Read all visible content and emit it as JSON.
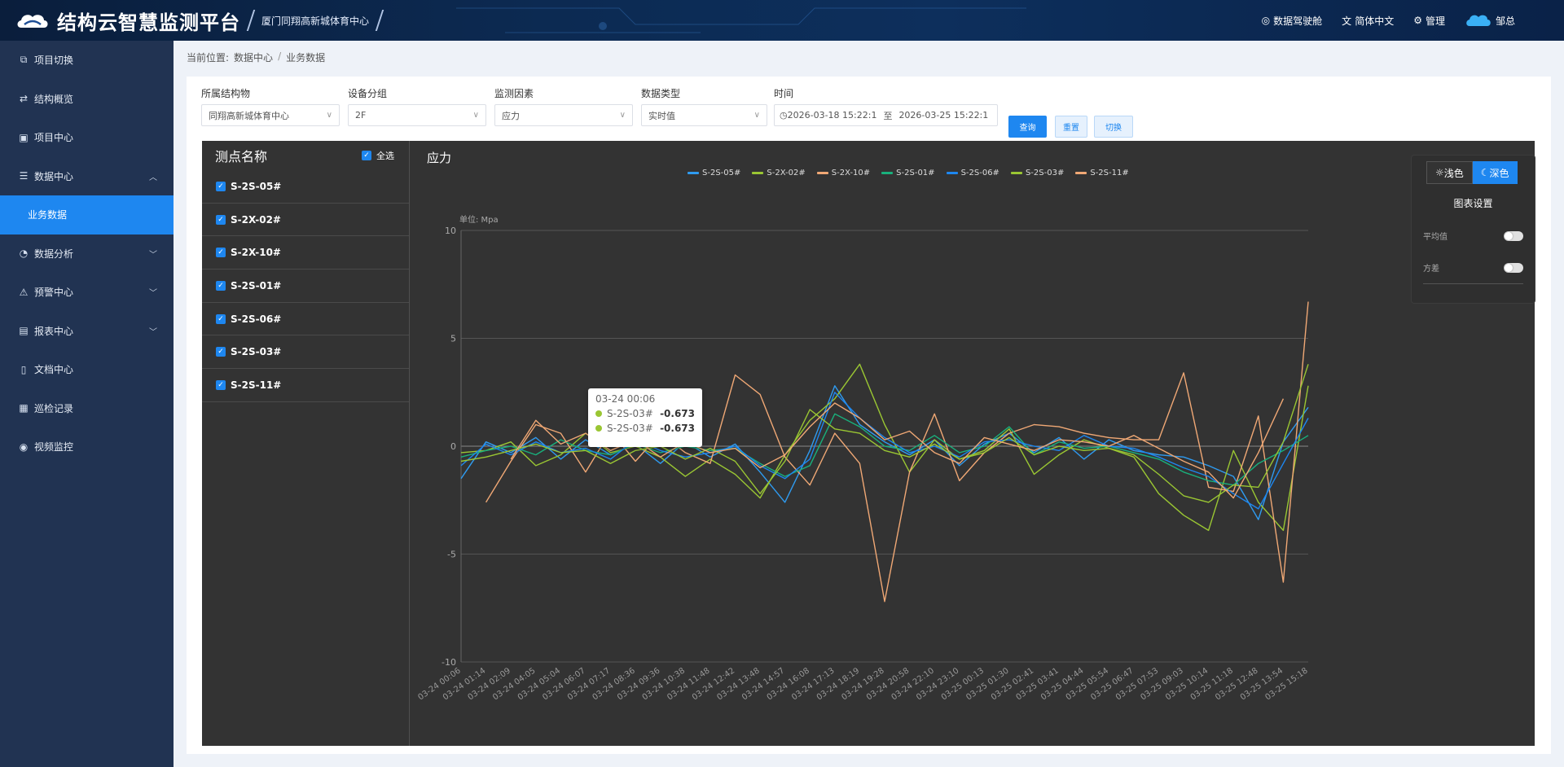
{
  "app": {
    "title": "结构云智慧监测平台",
    "project": "厦门同翔高新城体育中心"
  },
  "topbar": {
    "cockpit": "数据驾驶舱",
    "language": "简体中文",
    "admin": "管理",
    "user": "邹总"
  },
  "sidebar": {
    "items": [
      {
        "label": "项目切换",
        "icon": "switch-icon"
      },
      {
        "label": "结构概览",
        "icon": "structure-icon"
      },
      {
        "label": "项目中心",
        "icon": "project-icon"
      },
      {
        "label": "数据中心",
        "icon": "database-icon",
        "expanded": true
      },
      {
        "label": "业务数据",
        "sub": true,
        "active": true
      },
      {
        "label": "数据分析",
        "icon": "analysis-icon"
      },
      {
        "label": "预警中心",
        "icon": "alert-icon"
      },
      {
        "label": "报表中心",
        "icon": "report-icon"
      },
      {
        "label": "文档中心",
        "icon": "document-icon"
      },
      {
        "label": "巡检记录",
        "icon": "inspection-icon"
      },
      {
        "label": "视频监控",
        "icon": "camera-icon"
      }
    ]
  },
  "breadcrumb": {
    "prefix": "当前位置:",
    "level1": "数据中心",
    "separator": "/",
    "level2": "业务数据"
  },
  "filters": {
    "structure_label": "所属结构物",
    "structure_value": "同翔高新城体育中心",
    "group_label": "设备分组",
    "group_value": "2F",
    "factor_label": "监测因素",
    "factor_value": "应力",
    "datatype_label": "数据类型",
    "datatype_value": "实时值",
    "time_label": "时间",
    "time_start": "2026-03-18 15:22:1",
    "time_sep": "至",
    "time_end": "2026-03-25 15:22:1",
    "query": "查询",
    "reset": "重置",
    "switch": "切换"
  },
  "points": {
    "title": "测点名称",
    "select_all": "全选",
    "items": [
      "S-2S-05#",
      "S-2X-02#",
      "S-2X-10#",
      "S-2S-01#",
      "S-2S-06#",
      "S-2S-03#",
      "S-2S-11#"
    ]
  },
  "tooltip": {
    "time": "03-24 00:06",
    "rows": [
      {
        "name": "S-2S-03#",
        "value": "-0.673"
      },
      {
        "name": "S-2S-03#",
        "value": "-0.673"
      }
    ]
  },
  "settings": {
    "light": "浅色",
    "dark": "深色",
    "title": "图表设置",
    "avg": "平均值",
    "variance": "方差"
  },
  "chart_data": {
    "type": "line",
    "title": "应力",
    "unit_label": "单位:  Mpa",
    "ylim": [
      -10,
      10
    ],
    "yticks": [
      10,
      5,
      0,
      -5,
      -10
    ],
    "grid": true,
    "legend_position": "top-center",
    "categories": [
      "03-24 00:06",
      "03-24 01:14",
      "03-24 02:09",
      "03-24 04:05",
      "03-24 05:04",
      "03-24 06:07",
      "03-24 07:17",
      "03-24 08:36",
      "03-24 09:36",
      "03-24 10:38",
      "03-24 11:48",
      "03-24 12:42",
      "03-24 13:48",
      "03-24 14:57",
      "03-24 16:08",
      "03-24 17:13",
      "03-24 18:19",
      "03-24 19:28",
      "03-24 20:58",
      "03-24 22:10",
      "03-24 23:10",
      "03-25 00:13",
      "03-25 01:30",
      "03-25 02:41",
      "03-25 03:41",
      "03-25 04:44",
      "03-25 05:54",
      "03-25 06:47",
      "03-25 07:53",
      "03-25 09:03",
      "03-25 10:14",
      "03-25 11:18",
      "03-25 12:48",
      "03-25 13:54",
      "03-25 15:18"
    ],
    "series": [
      {
        "name": "S-2S-05#",
        "color": "#2f9bf0",
        "values": [
          -1.5,
          0.2,
          -0.3,
          0.4,
          -0.6,
          0.3,
          -0.4,
          0.1,
          -0.8,
          0.2,
          -0.5,
          0.1,
          -1.2,
          -2.6,
          -0.2,
          2.8,
          1.0,
          0.2,
          -0.4,
          0.3,
          -0.9,
          0.1,
          0.6,
          -0.3,
          0.4,
          -0.6,
          0.3,
          -0.2,
          -0.4,
          -0.5,
          -0.9,
          -1.4,
          -3.4,
          0.2,
          1.8
        ]
      },
      {
        "name": "S-2X-02#",
        "color": "#9ac633",
        "values": [
          -0.3,
          -0.2,
          0.2,
          -0.9,
          -0.4,
          0.6,
          -0.3,
          0.0,
          -0.5,
          -1.4,
          -0.6,
          -1.3,
          -2.4,
          -0.4,
          1.2,
          2.2,
          3.8,
          1.0,
          -1.2,
          0.3,
          -0.6,
          -0.2,
          0.8,
          -1.3,
          -0.4,
          0.3,
          -0.1,
          -0.5,
          -2.2,
          -3.2,
          -3.9,
          -0.2,
          -2.6,
          -3.9,
          2.8
        ]
      },
      {
        "name": "S-2X-10#",
        "color": "#f0a875",
        "values": [
          null,
          -2.6,
          -0.7,
          1.0,
          0.6,
          -1.2,
          0.7,
          -0.7,
          0.6,
          -0.3,
          -0.8,
          3.3,
          2.4,
          -0.5,
          -1.8,
          0.6,
          -0.8,
          -7.2,
          -1.2,
          1.5,
          -1.6,
          -0.3,
          0.6,
          1.0,
          0.9,
          0.6,
          0.4,
          0.3,
          0.3,
          3.4,
          -1.9,
          -2.1,
          1.4,
          -6.3,
          6.7
        ]
      },
      {
        "name": "S-2S-01#",
        "color": "#19b07c",
        "values": [
          -0.5,
          -0.2,
          0.0,
          -0.4,
          0.3,
          -0.2,
          -0.4,
          0.1,
          -0.3,
          0.0,
          -0.2,
          -0.1,
          -0.8,
          -1.4,
          -0.9,
          1.5,
          0.9,
          0.0,
          -0.2,
          0.5,
          -0.3,
          0.0,
          0.9,
          -0.4,
          0.2,
          -0.1,
          0.0,
          -0.3,
          -0.6,
          -1.2,
          -1.6,
          -1.8,
          -0.8,
          -0.2,
          0.5
        ]
      },
      {
        "name": "S-2S-06#",
        "color": "#1e87f0",
        "values": [
          -0.9,
          0.1,
          -0.4,
          0.2,
          -0.3,
          -0.1,
          -0.6,
          0.3,
          -0.2,
          -0.5,
          -0.3,
          0.0,
          -0.9,
          -1.5,
          -0.6,
          2.5,
          1.3,
          0.4,
          -0.3,
          0.0,
          -0.5,
          0.2,
          0.3,
          0.0,
          -0.2,
          0.5,
          0.0,
          -0.1,
          -0.5,
          -1.0,
          -1.4,
          -2.2,
          -2.9,
          -0.8,
          1.3
        ]
      },
      {
        "name": "S-2S-03#",
        "color": "#9ac633",
        "values": [
          -0.7,
          -0.5,
          -0.2,
          0.1,
          -0.3,
          -0.2,
          -0.8,
          -0.2,
          0.0,
          -0.6,
          -0.1,
          -0.7,
          -2.2,
          -0.7,
          1.7,
          0.8,
          0.6,
          -0.2,
          -0.5,
          0.1,
          -0.6,
          -0.3,
          0.4,
          -0.4,
          0.0,
          -0.2,
          -0.1,
          -0.4,
          -1.3,
          -2.3,
          -2.6,
          -1.8,
          -1.9,
          0.2,
          3.8
        ]
      },
      {
        "name": "S-2S-11#",
        "color": "#f0a875",
        "values": [
          null,
          null,
          -0.6,
          1.2,
          0.1,
          0.6,
          -0.2,
          0.3,
          -0.5,
          0.2,
          -0.3,
          -0.1,
          -1.0,
          -0.4,
          0.9,
          2.0,
          1.3,
          0.3,
          0.7,
          -0.3,
          -0.8,
          0.4,
          0.1,
          -0.2,
          0.3,
          0.2,
          0.0,
          0.5,
          -0.1,
          -0.7,
          -1.2,
          -2.4,
          -0.3,
          2.2,
          null
        ]
      }
    ]
  }
}
